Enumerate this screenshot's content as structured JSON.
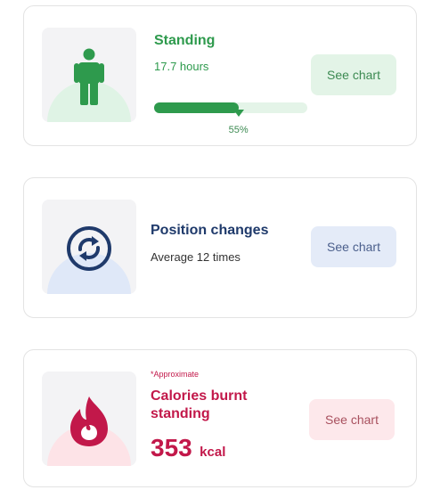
{
  "colors": {
    "standing_accent": "#2e9a4d",
    "position_accent": "#1f3a6b",
    "calories_accent": "#c2184a"
  },
  "standing": {
    "icon": "person-standing-icon",
    "title": "Standing",
    "subtitle": "17.7 hours",
    "progress_percent": 55,
    "progress_label": "55%",
    "button_label": "See chart"
  },
  "position": {
    "icon": "rotate-arrows-icon",
    "title": "Position changes",
    "subtitle": "Average 12 times",
    "button_label": "See chart"
  },
  "calories": {
    "icon": "flame-icon",
    "note": "*Approximate",
    "title_line1": "Calories burnt",
    "title_line2": "standing",
    "value": "353",
    "unit": "kcal",
    "button_label": "See chart"
  }
}
